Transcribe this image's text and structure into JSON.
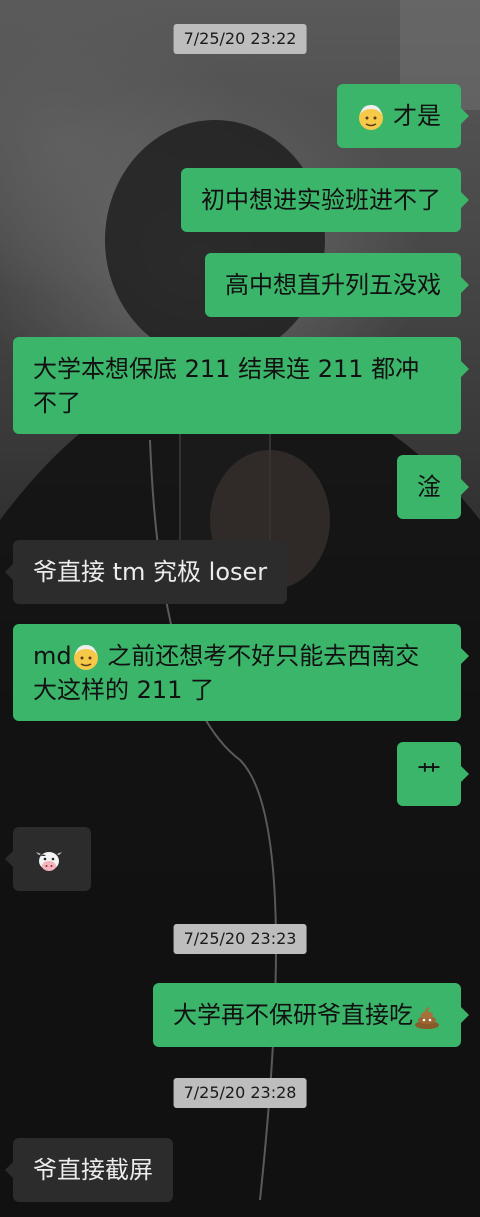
{
  "messages": [
    {
      "type": "timestamp",
      "text": "7/25/20 23:22"
    },
    {
      "type": "right",
      "emoji": "older-man-face",
      "text": "才是"
    },
    {
      "type": "right",
      "text": "初中想进实验班进不了"
    },
    {
      "type": "right",
      "text": "高中想直升列五没戏"
    },
    {
      "type": "right",
      "text": "大学本想保底 211 结果连 211 都冲不了"
    },
    {
      "type": "right",
      "text": "淦"
    },
    {
      "type": "left",
      "text": "爷直接 tm 究极 loser"
    },
    {
      "type": "right",
      "pre": "md",
      "emoji": "older-man-face",
      "text": "之前还想考不好只能去西南交大这样的 211 了"
    },
    {
      "type": "right",
      "text": "艹"
    },
    {
      "type": "left",
      "emoji": "cow-face"
    },
    {
      "type": "timestamp",
      "text": "7/25/20 23:23"
    },
    {
      "type": "right",
      "text": "大学再不保研爷直接吃",
      "emoji_after": "pile-of-poo"
    },
    {
      "type": "timestamp",
      "text": "7/25/20 23:28"
    },
    {
      "type": "left",
      "text": "爷直接截屏"
    }
  ],
  "colors": {
    "sent_bubble": "#3bb56a",
    "received_bubble": "#2c2c2c",
    "timestamp_bg": "#bdbdbd"
  }
}
